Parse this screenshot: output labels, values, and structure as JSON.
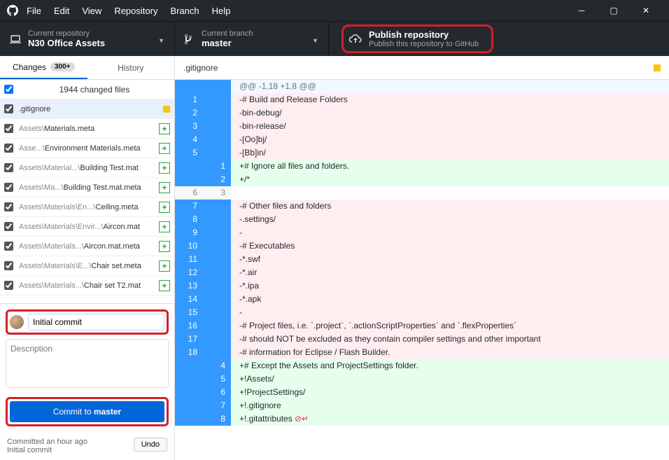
{
  "menu": {
    "file": "File",
    "edit": "Edit",
    "view": "View",
    "repository": "Repository",
    "branch": "Branch",
    "help": "Help"
  },
  "repo": {
    "label": "Current repository",
    "name": "N30 Office Assets"
  },
  "branch": {
    "label": "Current branch",
    "name": "master"
  },
  "publish": {
    "title": "Publish repository",
    "subtitle": "Publish this repository to GitHub"
  },
  "tabs": {
    "changes": "Changes",
    "changes_badge": "300+",
    "history": "History"
  },
  "summary_count": "1944 changed files",
  "files": [
    {
      "grey": "",
      "name": ".gitignore",
      "status": "mod",
      "selected": true
    },
    {
      "grey": "Assets\\",
      "name": "Materials.meta",
      "status": "add"
    },
    {
      "grey": "Asse...\\",
      "name": "Environment Materials.meta",
      "status": "add"
    },
    {
      "grey": "Assets\\Material...\\",
      "name": "Building Test.mat",
      "status": "add"
    },
    {
      "grey": "Assets\\Ma...\\",
      "name": "Building Test.mat.meta",
      "status": "add"
    },
    {
      "grey": "Assets\\Materials\\En...\\",
      "name": "Ceiling.meta",
      "status": "add"
    },
    {
      "grey": "Assets\\Materials\\Envir...\\",
      "name": "Aircon.mat",
      "status": "add"
    },
    {
      "grey": "Assets\\Materials...\\",
      "name": "Aircon.mat.meta",
      "status": "add"
    },
    {
      "grey": "Assets\\Materials\\E...\\",
      "name": "Chair set.meta",
      "status": "add"
    },
    {
      "grey": "Assets\\Materials...\\",
      "name": "Chair set T2.mat",
      "status": "add"
    }
  ],
  "commit": {
    "summary_value": "Initial commit",
    "description_placeholder": "Description",
    "button_prefix": "Commit to ",
    "button_branch": "master"
  },
  "last": {
    "time": "Committed an hour ago",
    "msg": "Initial commit",
    "undo": "Undo"
  },
  "diff": {
    "filename": ".gitignore",
    "lines": [
      {
        "t": "hunk",
        "o": "",
        "n": "",
        "c": "@@ -1,18 +1,8 @@"
      },
      {
        "t": "del",
        "o": "1",
        "n": "",
        "c": "-# Build and Release Folders"
      },
      {
        "t": "del",
        "o": "2",
        "n": "",
        "c": "-bin-debug/"
      },
      {
        "t": "del",
        "o": "3",
        "n": "",
        "c": "-bin-release/"
      },
      {
        "t": "del",
        "o": "4",
        "n": "",
        "c": "-[Oo]bj/"
      },
      {
        "t": "del",
        "o": "5",
        "n": "",
        "c": "-[Bb]in/"
      },
      {
        "t": "add",
        "o": "",
        "n": "1",
        "c": "+# Ignore all files and folders."
      },
      {
        "t": "add",
        "o": "",
        "n": "2",
        "c": "+/*"
      },
      {
        "t": "gap",
        "o": "6",
        "n": "3",
        "c": ""
      },
      {
        "t": "del",
        "o": "7",
        "n": "",
        "c": "-# Other files and folders"
      },
      {
        "t": "del",
        "o": "8",
        "n": "",
        "c": "-.settings/"
      },
      {
        "t": "del",
        "o": "9",
        "n": "",
        "c": "-"
      },
      {
        "t": "del",
        "o": "10",
        "n": "",
        "c": "-# Executables"
      },
      {
        "t": "del",
        "o": "11",
        "n": "",
        "c": "-*.swf"
      },
      {
        "t": "del",
        "o": "12",
        "n": "",
        "c": "-*.air"
      },
      {
        "t": "del",
        "o": "13",
        "n": "",
        "c": "-*.ipa"
      },
      {
        "t": "del",
        "o": "14",
        "n": "",
        "c": "-*.apk"
      },
      {
        "t": "del",
        "o": "15",
        "n": "",
        "c": "-"
      },
      {
        "t": "del",
        "o": "16",
        "n": "",
        "c": "-# Project files, i.e. `.project`, `.actionScriptProperties` and `.flexProperties`"
      },
      {
        "t": "del",
        "o": "17",
        "n": "",
        "c": "-# should NOT be excluded as they contain compiler settings and other important"
      },
      {
        "t": "del",
        "o": "18",
        "n": "",
        "c": "-# information for Eclipse / Flash Builder."
      },
      {
        "t": "add",
        "o": "",
        "n": "4",
        "c": "+# Except the Assets and ProjectSettings folder."
      },
      {
        "t": "add",
        "o": "",
        "n": "5",
        "c": "+!Assets/"
      },
      {
        "t": "add",
        "o": "",
        "n": "6",
        "c": "+!ProjectSettings/"
      },
      {
        "t": "add",
        "o": "",
        "n": "7",
        "c": "+!.gitignore"
      },
      {
        "t": "add",
        "o": "",
        "n": "8",
        "c": "+!.gitattributes ",
        "eof": true
      }
    ]
  }
}
